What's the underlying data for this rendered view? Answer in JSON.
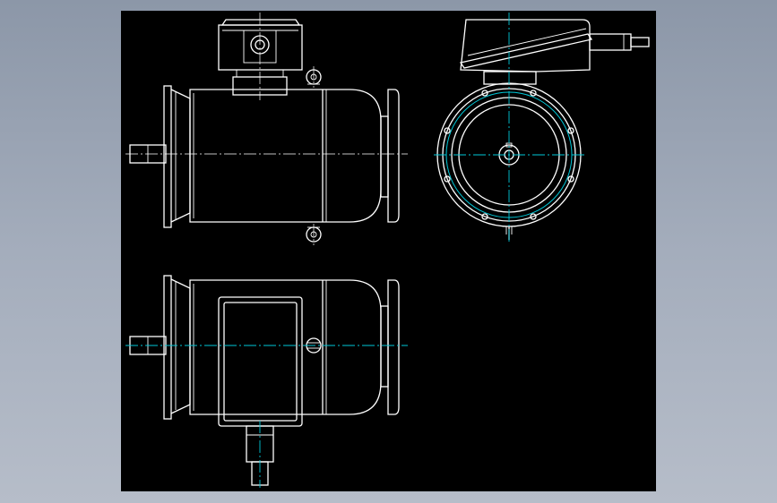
{
  "drawing": {
    "background": "#000000",
    "line_color": "#ffffff",
    "centerline_color": "#00c8d8",
    "views": [
      "front-view",
      "end-view",
      "top-view"
    ]
  }
}
